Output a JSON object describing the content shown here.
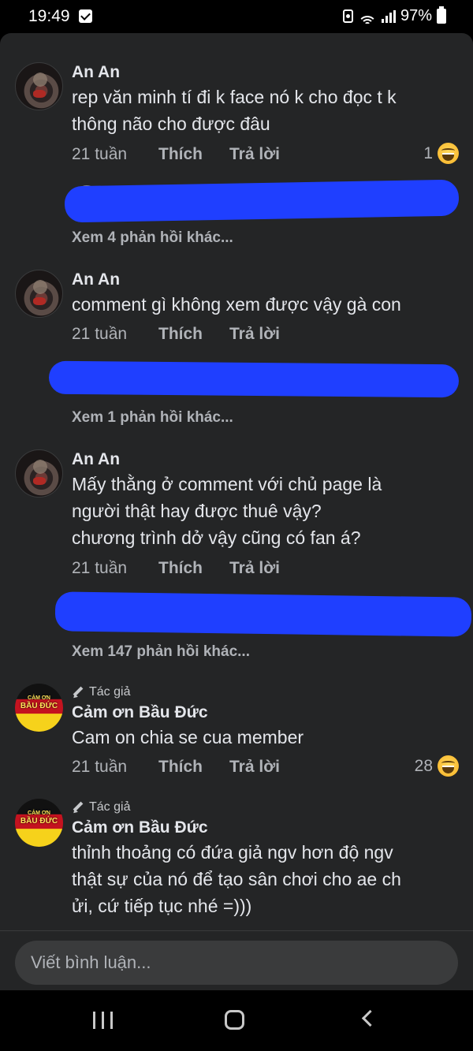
{
  "status": {
    "time": "19:49",
    "battery": "97%"
  },
  "comments": [
    {
      "name": "An An",
      "text": [
        "rep văn minh tí đi k face nó k cho đọc t k",
        "thông não cho được đâu"
      ],
      "time": "21 tuần",
      "like": "Thích",
      "reply": "Trả lời",
      "reactions": "1",
      "more": "Xem 4 phản hồi khác..."
    },
    {
      "name": "An An",
      "text": [
        "comment gì không xem được vậy gà con"
      ],
      "time": "21 tuần",
      "like": "Thích",
      "reply": "Trả lời",
      "more": "Xem 1 phản hồi khác..."
    },
    {
      "name": "An An",
      "text": [
        "Mấy thằng ở comment với chủ page là",
        "người thật hay được thuê vậy?",
        "chương trình dở vậy cũng có fan á?"
      ],
      "time": "21 tuần",
      "like": "Thích",
      "reply": "Trả lời",
      "more": "Xem 147 phản hồi khác..."
    },
    {
      "author_tag": "Tác giả",
      "avatar_text": [
        "CẢM ƠN",
        "BẦU ĐỨC"
      ],
      "name": "Cảm ơn Bầu Đức",
      "text": [
        "Cam on chia se cua member"
      ],
      "time": "21 tuần",
      "like": "Thích",
      "reply": "Trả lời",
      "reactions": "28"
    },
    {
      "author_tag": "Tác giả",
      "avatar_text": [
        "CẢM ƠN",
        "BẦU ĐỨC"
      ],
      "name": "Cảm ơn Bầu Đức",
      "text": [
        "thỉnh thoảng có đứa giả ngv hơn độ ngv",
        "thật sự của nó để tạo sân chơi cho ae ch",
        "ửi, cứ tiếp tục nhé =)))"
      ]
    }
  ],
  "composer": {
    "placeholder": "Viết bình luận..."
  },
  "icons": [
    "check-icon",
    "lock-icon",
    "wifi-icon",
    "signal-icon",
    "battery-icon",
    "haha-reaction-icon",
    "pencil-icon",
    "recent-apps-icon",
    "home-icon",
    "back-icon"
  ]
}
